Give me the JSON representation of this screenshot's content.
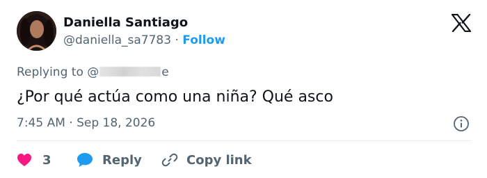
{
  "author": {
    "name": "Daniella Santiago",
    "handle": "@daniella_sa7783",
    "separator": "·",
    "follow_label": "Follow"
  },
  "reply_context": {
    "prefix": "Replying to @",
    "suffix": "e"
  },
  "tweet": {
    "text": "¿Por qué actúa como una niña? Qué asco",
    "timestamp": "7:45 AM · Sep 18, 2026"
  },
  "actions": {
    "like_count": "3",
    "reply_label": "Reply",
    "copy_label": "Copy link"
  },
  "icons": {
    "brand": "x-logo-icon",
    "info": "info-icon",
    "like": "heart-icon",
    "reply": "speech-bubble-icon",
    "copy": "link-icon"
  },
  "colors": {
    "text": "#0f1419",
    "secondary": "#536471",
    "accent": "#1d9bf0",
    "like": "#f91880"
  }
}
